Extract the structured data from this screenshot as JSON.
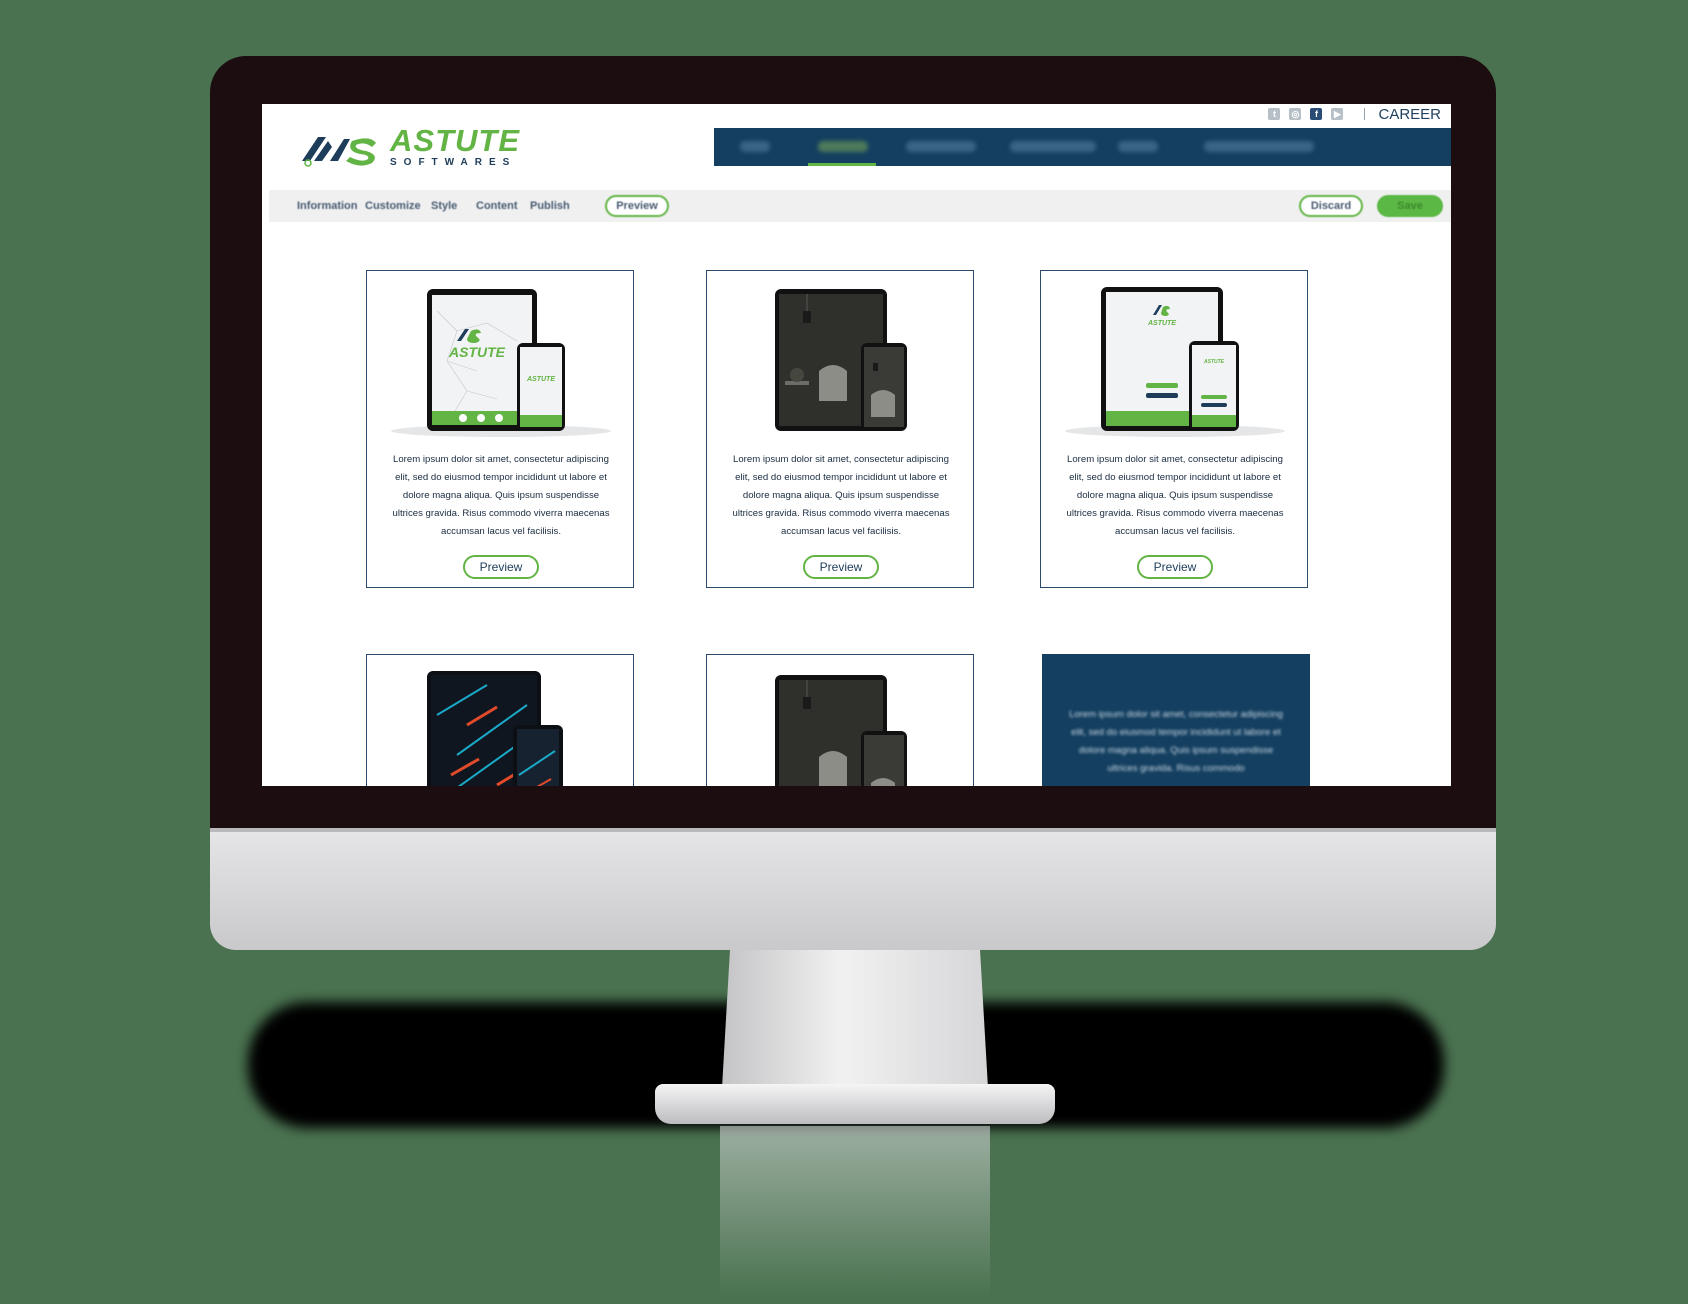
{
  "brand": {
    "name": "ASTUTE",
    "subname": "SOFTWARES",
    "green": "#62b445",
    "navy": "#143f60"
  },
  "topbar": {
    "social_icons": [
      "twitter-icon",
      "instagram-icon",
      "facebook-icon",
      "youtube-icon"
    ],
    "career_label": "CAREER"
  },
  "editor_toolbar": {
    "tabs": [
      "Information",
      "Customize",
      "Style",
      "Content",
      "Publish"
    ],
    "active_tab": "Preview",
    "discard_label": "Discard",
    "save_label": "Save"
  },
  "cards": [
    {
      "theme": "light-network",
      "description": "Lorem ipsum dolor sit amet, consectetur adipiscing elit, sed do eiusmod tempor incididunt ut labore et dolore magna aliqua. Quis ipsum suspendisse ultrices gravida. Risus commodo viverra maecenas accumsan lacus vel facilisis.",
      "button_label": "Preview"
    },
    {
      "theme": "dark-interior",
      "description": "Lorem ipsum dolor sit amet, consectetur adipiscing elit, sed do eiusmod tempor incididunt ut labore et dolore magna aliqua. Quis ipsum suspendisse ultrices gravida. Risus commodo viverra maecenas accumsan lacus vel facilisis.",
      "button_label": "Preview"
    },
    {
      "theme": "light-login",
      "description": "Lorem ipsum dolor sit amet, consectetur adipiscing elit, sed do eiusmod tempor incididunt ut labore et dolore magna aliqua. Quis ipsum suspendisse ultrices gravida. Risus commodo viverra maecenas accumsan lacus vel facilisis.",
      "button_label": "Preview"
    },
    {
      "theme": "neon-abstract"
    },
    {
      "theme": "dark-interior"
    }
  ],
  "promo_card": {
    "text": "Lorem ipsum dolor sit amet, consectetur adipiscing elit, sed do eiusmod tempor incididunt ut labore et dolore magna aliqua. Quis ipsum suspendisse ultrices gravida. Risus commodo"
  }
}
